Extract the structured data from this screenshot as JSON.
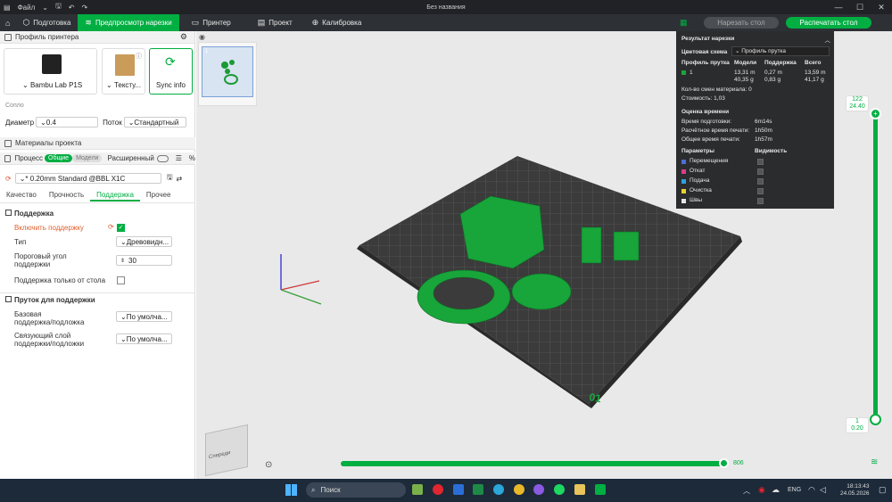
{
  "titlebar": {
    "menu": "Файл",
    "window_title": "Без названия"
  },
  "tabs": [
    {
      "label": "Подготовка"
    },
    {
      "label": "Предпросмотр нарезки"
    },
    {
      "label": "Принтер"
    },
    {
      "label": "Проект"
    },
    {
      "label": "Калибровка"
    }
  ],
  "actions": {
    "slice": "Нарезать стол",
    "print": "Распечатать стол"
  },
  "left": {
    "printer_profile": "Профиль принтера",
    "printer_name": "Bambu Lab P1S",
    "plate_name": "Тексту...",
    "sync": "Sync info",
    "nozzle": "Сопло",
    "diameter_label": "Диаметр",
    "diameter": "0.4",
    "flow_label": "Поток",
    "flow": "Стандартный",
    "materials": "Материалы проекта",
    "process": "Процесс",
    "seg_global": "Общие",
    "seg_models": "Модели",
    "advanced": "Расширенный",
    "profile": "* 0.20mm Standard @BBL X1C",
    "subtabs": [
      "Качество",
      "Прочность",
      "Поддержка",
      "Прочее"
    ],
    "support_h": "Поддержка",
    "enable_support": "Включить поддержку",
    "type_label": "Тип",
    "type_value": "Древовидн...",
    "angle_label_1": "Пороговый угол",
    "angle_label_2": "поддержки",
    "angle_value": "30",
    "bed_only": "Поддержка только от стола",
    "filament_h": "Пруток для поддержки",
    "base_label_1": "Базовая",
    "base_label_2": "поддержка/подложка",
    "base_value": "По умолча...",
    "iface_label_1": "Связующий слой",
    "iface_label_2": "поддержки/подложки",
    "iface_value": "По умолча..."
  },
  "result": {
    "title": "Результат нарезки",
    "scheme_label": "Цветовая схема",
    "scheme_value": "Профиль прутка",
    "cols": [
      "Профиль прутка",
      "Модели",
      "Поддержка",
      "Всего"
    ],
    "row_id": "1",
    "models": "13,31 m",
    "models_g": "40,35 g",
    "support": "0,27 m",
    "support_g": "0,83 g",
    "total": "13,59 m",
    "total_g": "41,17 g",
    "changes": "Кол-во смен материала:  0",
    "cost": "Стоимость:  1,03",
    "time_h": "Оценка времени",
    "prep_label": "Время подготовки:",
    "prep": "6m14s",
    "est_label": "Расчётное время печати:",
    "est": "1h50m",
    "total_time_label": "Общее время печати:",
    "total_time": "1h57m",
    "params": "Параметры",
    "visibility": "Видимость",
    "legend": [
      {
        "label": "Перемещения",
        "color": "#4a6fd6"
      },
      {
        "label": "Откат",
        "color": "#e03a8c"
      },
      {
        "label": "Подача",
        "color": "#2ea0e0"
      },
      {
        "label": "Очистка",
        "color": "#e6d52a"
      },
      {
        "label": "Швы",
        "color": "#e6e6e6"
      }
    ]
  },
  "layers": {
    "top_num": "122",
    "top_h": "24.40",
    "bottom_num": "1",
    "bottom_h": "0.20",
    "moves": "806"
  },
  "plate_label": "01",
  "plate_thumb": "1",
  "cube_front": "Спереди",
  "taskbar": {
    "search": "Поиск",
    "lang": "ENG",
    "time": "18:13:43",
    "date": "24.05.2026"
  },
  "colors": {
    "accent": "#00ae42",
    "model": "#18a53a",
    "plate": "#3b3b3b"
  }
}
